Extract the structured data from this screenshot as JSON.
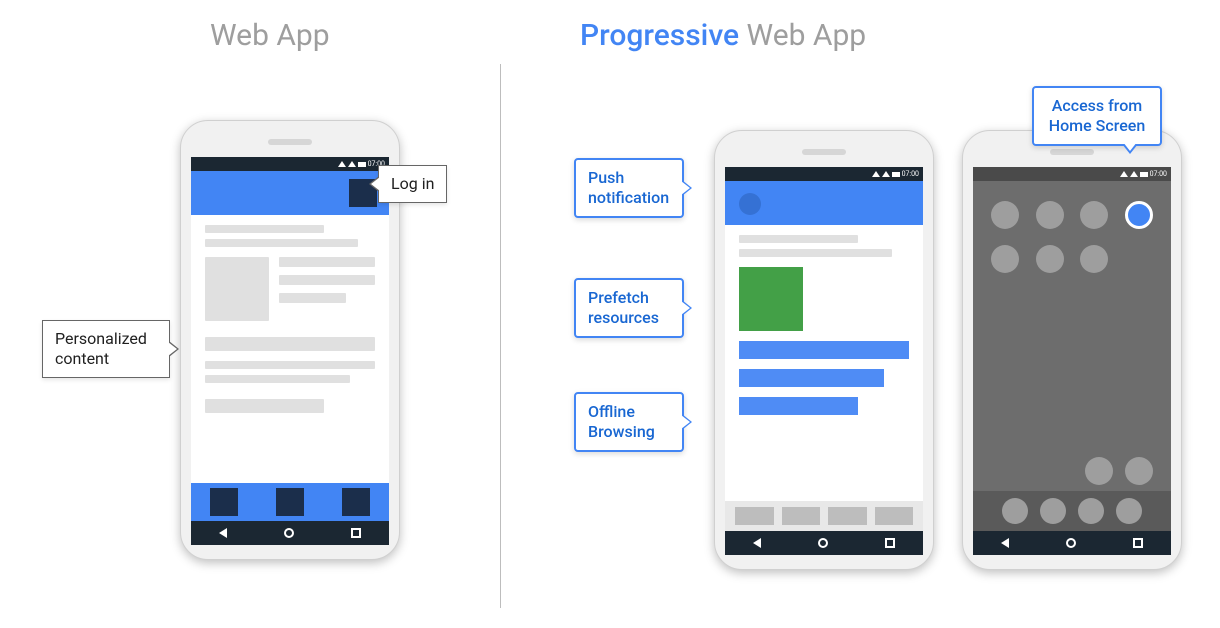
{
  "headings": {
    "web_app": "Web App",
    "pwa_prefix": "Progressive",
    "pwa_suffix": " Web App"
  },
  "statusbar": {
    "clock": "07:00"
  },
  "callouts": {
    "login": "Log in",
    "personalized": "Personalized content",
    "push": "Push notification",
    "prefetch": "Prefetch resources",
    "offline": "Offline Browsing",
    "homescreen": "Access from Home Screen"
  }
}
